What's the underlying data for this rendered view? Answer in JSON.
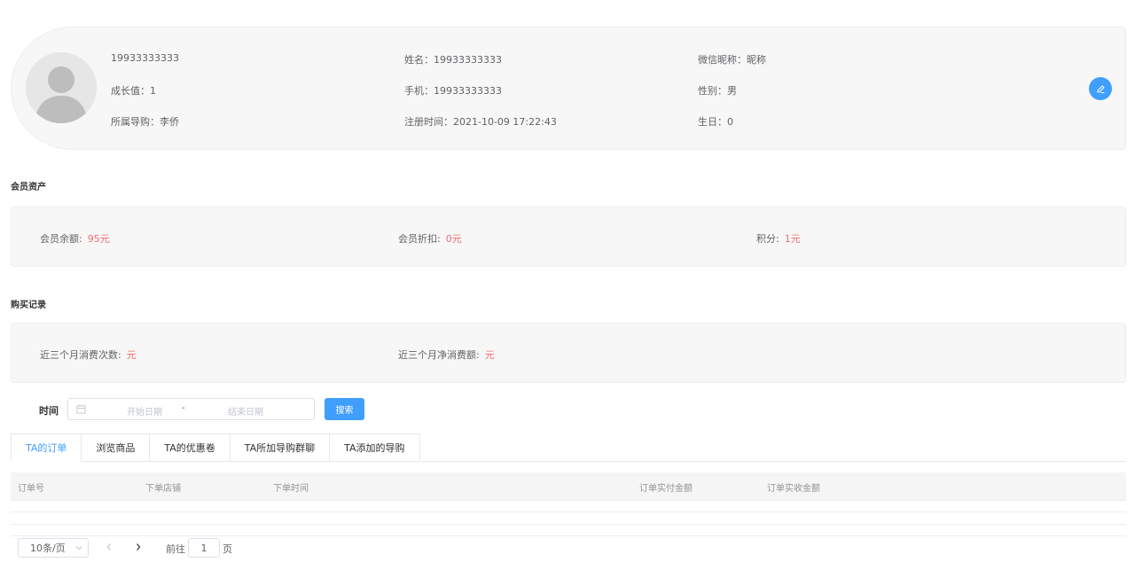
{
  "profile": {
    "account": "19933333333",
    "growth": "成长值：1",
    "guide": "所属导购：李侨",
    "name": "姓名：19933333333",
    "phone": "手机：19933333333",
    "register_time": "注册时间：2021-10-09 17:22:43",
    "wechat_nickname": "微信昵称：昵称",
    "gender": "性别：男",
    "birthday": "生日：0",
    "avatar_icon": "user-avatar-icon",
    "edit_icon": "edit-icon"
  },
  "assets": {
    "title": "会员资产",
    "balance_label": "会员余额:",
    "balance_value": "95元",
    "discount_label": "会员折扣:",
    "discount_value": "0元",
    "points_label": "积分:",
    "points_value": "1元"
  },
  "purchase": {
    "title": "购买记录",
    "count_label": "近三个月消费次数:",
    "count_value": "元",
    "amount_label": "近三个月净消费额:",
    "amount_value": "元"
  },
  "filter": {
    "time_label": "时间",
    "start_placeholder": "开始日期",
    "separator": "-",
    "end_placeholder": "结束日期",
    "search_label": "搜索",
    "calendar_icon": "calendar-icon"
  },
  "tabs": [
    {
      "label": "TA的订单",
      "active": true
    },
    {
      "label": "浏览商品",
      "active": false
    },
    {
      "label": "TA的优惠卷",
      "active": false
    },
    {
      "label": "TA所加导购群聊",
      "active": false
    },
    {
      "label": "TA添加的导购",
      "active": false
    }
  ],
  "table": {
    "columns": [
      "订单号",
      "下单店铺",
      "下单时间",
      "订单实付金额",
      "订单实收金额"
    ],
    "rows": []
  },
  "pagination": {
    "page_size": "10条/页",
    "goto_label": "前往",
    "current_page": "1",
    "page_unit": "页"
  },
  "colors": {
    "accent": "#409eff",
    "value_red": "#f56c6c",
    "panel_bg": "#f7f7f7"
  }
}
